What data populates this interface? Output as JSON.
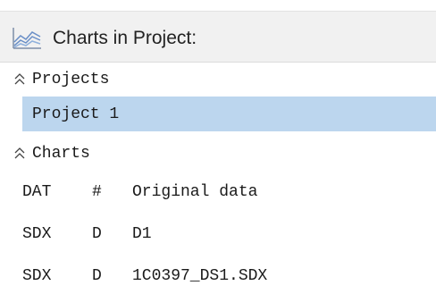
{
  "header": {
    "title": "Charts in Project:",
    "icon": "area-chart-icon"
  },
  "projects_section": {
    "label": "Projects",
    "icon": "collapse-chevrons-icon",
    "items": [
      {
        "label": "Project 1",
        "selected": true
      }
    ]
  },
  "charts_section": {
    "label": "Charts",
    "icon": "collapse-chevrons-icon",
    "rows": [
      {
        "type": "DAT",
        "flag": "#",
        "name": "Original data"
      },
      {
        "type": "SDX",
        "flag": "D",
        "name": "D1"
      },
      {
        "type": "SDX",
        "flag": "D",
        "name": "1C0397_DS1.SDX"
      }
    ]
  },
  "colors": {
    "header_bg": "#f1f1f1",
    "selection_bg": "#bcd6ee",
    "chart_icon_blue": "#6a8fc7"
  }
}
